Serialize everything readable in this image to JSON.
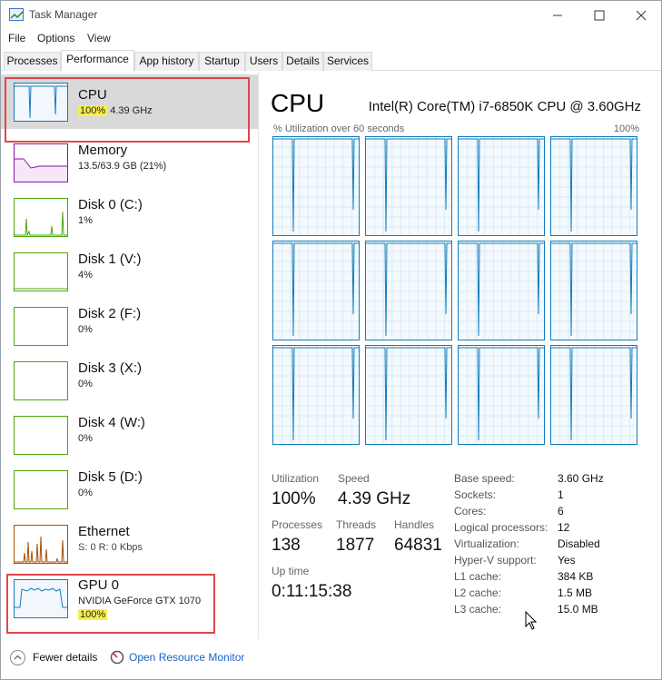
{
  "window": {
    "title": "Task Manager"
  },
  "menu": [
    "File",
    "Options",
    "View"
  ],
  "tabs": [
    "Processes",
    "Performance",
    "App history",
    "Startup",
    "Users",
    "Details",
    "Services"
  ],
  "active_tab": "Performance",
  "sidebar": {
    "items": [
      {
        "name": "CPU",
        "sub": "4.39 GHz",
        "highlight": "100%",
        "icon": "cpu-graph"
      },
      {
        "name": "Memory",
        "sub": "13.5/63.9 GB (21%)",
        "icon": "memory-graph"
      },
      {
        "name": "Disk 0 (C:)",
        "sub": "1%",
        "icon": "disk-graph"
      },
      {
        "name": "Disk 1 (V:)",
        "sub": "4%",
        "icon": "disk-graph"
      },
      {
        "name": "Disk 2 (F:)",
        "sub": "0%",
        "icon": "disk-graph"
      },
      {
        "name": "Disk 3 (X:)",
        "sub": "0%",
        "icon": "disk-graph"
      },
      {
        "name": "Disk 4 (W:)",
        "sub": "0%",
        "icon": "disk-graph"
      },
      {
        "name": "Disk 5 (D:)",
        "sub": "0%",
        "icon": "disk-graph"
      },
      {
        "name": "Ethernet",
        "sub": "S: 0 R: 0 Kbps",
        "icon": "ethernet-graph"
      },
      {
        "name": "GPU 0",
        "sub": "NVIDIA GeForce GTX 1070",
        "highlight": "100%",
        "icon": "gpu-graph"
      }
    ]
  },
  "cpu": {
    "title": "CPU",
    "model": "Intel(R) Core(TM) i7-6850K CPU @ 3.60GHz",
    "graph_label": "% Utilization over 60 seconds",
    "graph_max": "100%",
    "stats": {
      "utilization_label": "Utilization",
      "utilization": "100%",
      "speed_label": "Speed",
      "speed": "4.39 GHz",
      "processes_label": "Processes",
      "processes": "138",
      "threads_label": "Threads",
      "threads": "1877",
      "handles_label": "Handles",
      "handles": "64831",
      "uptime_label": "Up time",
      "uptime": "0:11:15:38"
    },
    "details": [
      {
        "label": "Base speed:",
        "value": "3.60 GHz"
      },
      {
        "label": "Sockets:",
        "value": "1"
      },
      {
        "label": "Cores:",
        "value": "6"
      },
      {
        "label": "Logical processors:",
        "value": "12"
      },
      {
        "label": "Virtualization:",
        "value": "Disabled"
      },
      {
        "label": "Hyper-V support:",
        "value": "Yes"
      },
      {
        "label": "L1 cache:",
        "value": "384 KB"
      },
      {
        "label": "L2 cache:",
        "value": "1.5 MB"
      },
      {
        "label": "L3 cache:",
        "value": "15.0 MB"
      }
    ]
  },
  "footer": {
    "fewer_details": "Fewer details",
    "resource_monitor": "Open Resource Monitor"
  },
  "colors": {
    "cpu": "#117dbb",
    "memory": "#8b12ae",
    "disk": "#4da60c",
    "ethernet": "#a74f01",
    "highlight": "#f7ee4f",
    "annotation": "#e0464a"
  }
}
